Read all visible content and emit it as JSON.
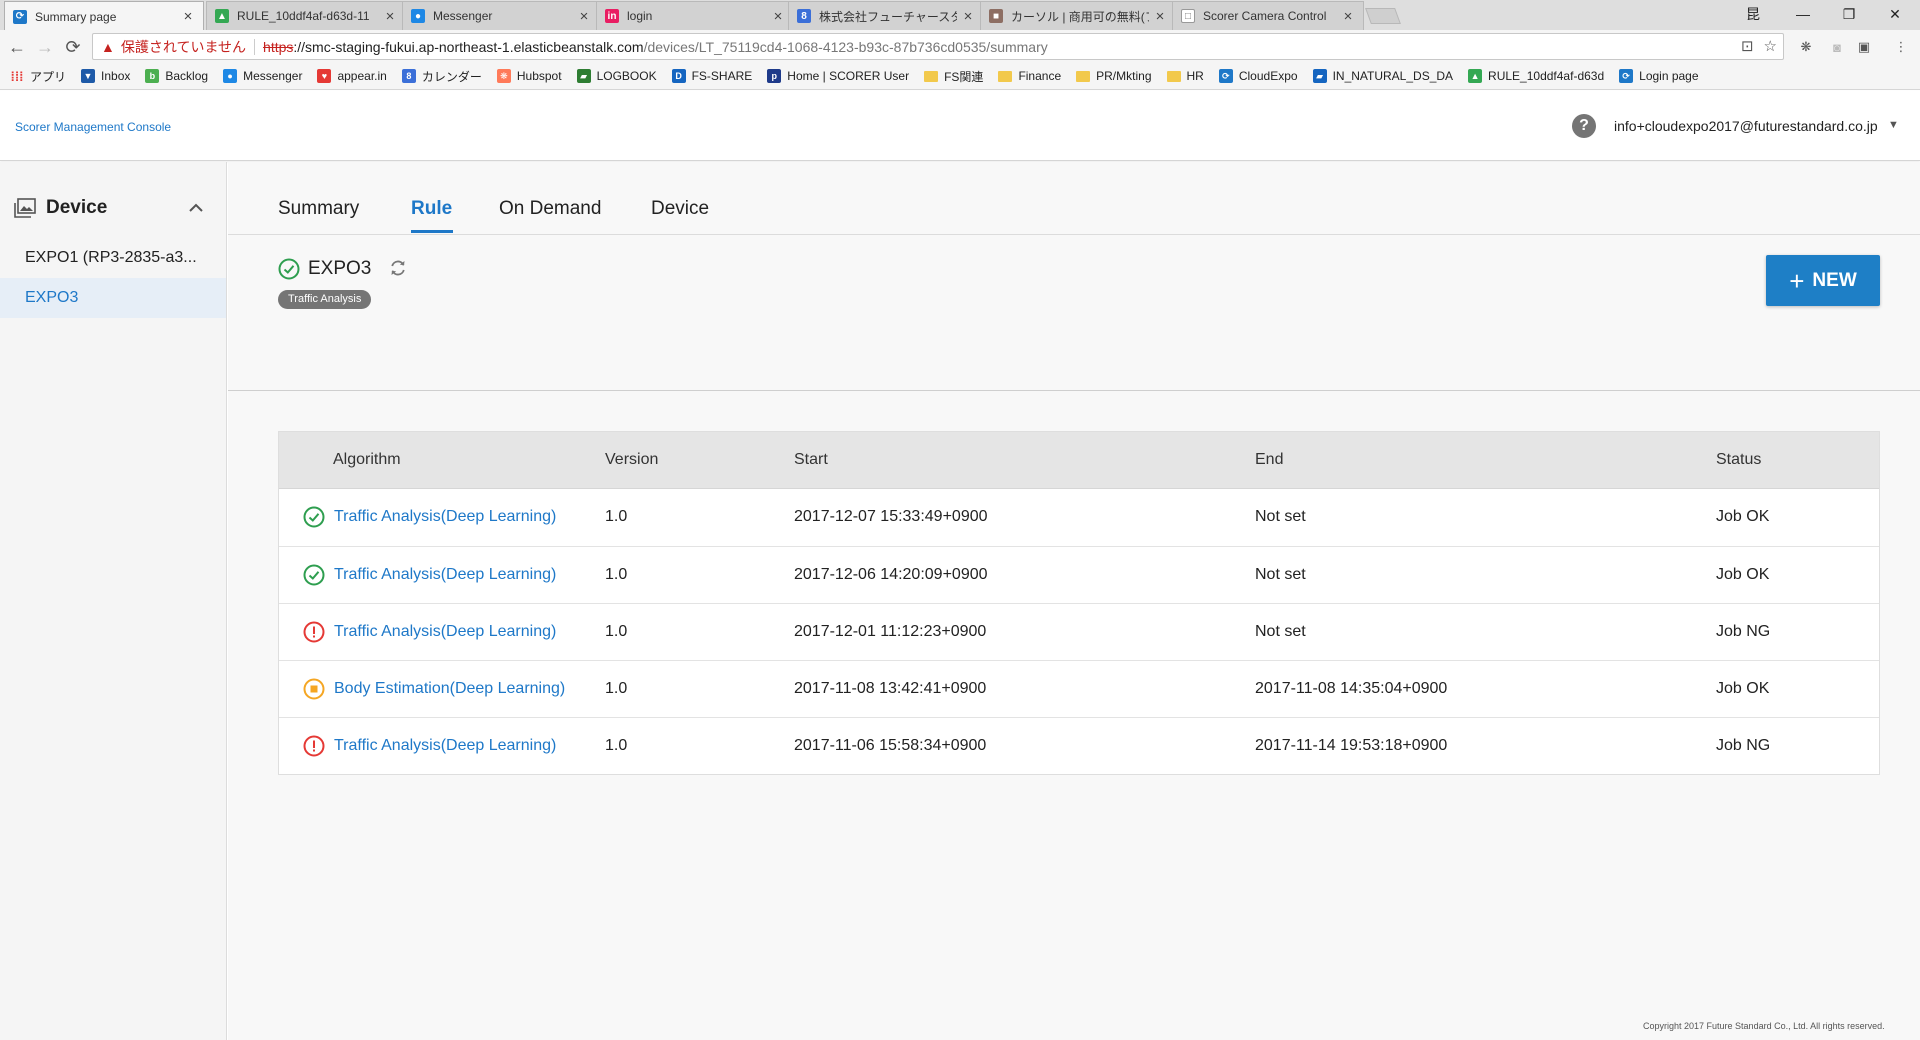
{
  "browser": {
    "tabs": [
      {
        "title": "Summary page",
        "fav_color": "#1e78c8",
        "fav_glyph": "⟳"
      },
      {
        "title": "RULE_10ddf4af-d63d-11",
        "fav_color": "#34a853",
        "fav_glyph": "▲"
      },
      {
        "title": "Messenger",
        "fav_color": "#1e88e5",
        "fav_glyph": "●"
      },
      {
        "title": "login",
        "fav_color": "#e91e63",
        "fav_glyph": "in"
      },
      {
        "title": "株式会社フューチャースタンダ",
        "fav_color": "#3b6fd8",
        "fav_glyph": "8"
      },
      {
        "title": "カーソル | 商用可の無料(フ",
        "fav_color": "#8d6e63",
        "fav_glyph": "■"
      },
      {
        "title": "Scorer Camera Control",
        "fav_color": "#ffffff",
        "fav_glyph": "□"
      }
    ],
    "window_controls": {
      "profile": "昆",
      "minimize": "—",
      "restore": "❐",
      "close": "✕"
    },
    "omnibox": {
      "security_warning": "保護されていません",
      "scheme": "https",
      "host_url": "://smc-staging-fukui.ap-northeast-1.elasticbeanstalk.com",
      "path": "/devices/LT_75119cd4-1068-4123-b93c-87b736cd0535/summary"
    },
    "bookmarks": [
      {
        "label": "アプリ",
        "type": "apps",
        "color": "#e53935"
      },
      {
        "label": "Inbox",
        "type": "icon",
        "color": "#1e5aa8",
        "glyph": "▼"
      },
      {
        "label": "Backlog",
        "type": "icon",
        "color": "#4caf50",
        "glyph": "b"
      },
      {
        "label": "Messenger",
        "type": "icon",
        "color": "#1e88e5",
        "glyph": "●"
      },
      {
        "label": "appear.in",
        "type": "icon",
        "color": "#e53935",
        "glyph": "♥"
      },
      {
        "label": "カレンダー",
        "type": "icon",
        "color": "#3b6fd8",
        "glyph": "8"
      },
      {
        "label": "Hubspot",
        "type": "icon",
        "color": "#ff7a59",
        "glyph": "❋"
      },
      {
        "label": "LOGBOOK",
        "type": "icon",
        "color": "#2e7d32",
        "glyph": "▰"
      },
      {
        "label": "FS-SHARE",
        "type": "icon",
        "color": "#1565c0",
        "glyph": "D"
      },
      {
        "label": "Home | SCORER User",
        "type": "icon",
        "color": "#1e3a8a",
        "glyph": "p"
      },
      {
        "label": "FS関連",
        "type": "folder"
      },
      {
        "label": "Finance",
        "type": "folder"
      },
      {
        "label": "PR/Mkting",
        "type": "folder"
      },
      {
        "label": "HR",
        "type": "folder"
      },
      {
        "label": "CloudExpo",
        "type": "icon",
        "color": "#1e78c8",
        "glyph": "⟳"
      },
      {
        "label": "IN_NATURAL_DS_DA",
        "type": "icon",
        "color": "#1565c0",
        "glyph": "▰"
      },
      {
        "label": "RULE_10ddf4af-d63d",
        "type": "icon",
        "color": "#34a853",
        "glyph": "▲"
      },
      {
        "label": "Login page",
        "type": "icon",
        "color": "#1e78c8",
        "glyph": "⟳"
      }
    ]
  },
  "header": {
    "brand": "Scorer Management Console",
    "user_email": "info+cloudexpo2017@futurestandard.co.jp"
  },
  "sidebar": {
    "title": "Device",
    "items": [
      {
        "label": "EXPO1 (RP3-2835-a3...",
        "selected": false
      },
      {
        "label": "EXPO3",
        "selected": true
      }
    ]
  },
  "tabs": [
    {
      "label": "Summary",
      "active": false
    },
    {
      "label": "Rule",
      "active": true
    },
    {
      "label": "On Demand",
      "active": false
    },
    {
      "label": "Device",
      "active": false
    }
  ],
  "device": {
    "name": "EXPO3",
    "badge": "Traffic Analysis",
    "new_button": "NEW"
  },
  "table": {
    "columns": [
      "Algorithm",
      "Version",
      "Start",
      "End",
      "Status"
    ],
    "rows": [
      {
        "status_icon": "ok",
        "algorithm": "Traffic Analysis(Deep Learning)",
        "version": "1.0",
        "start": "2017-12-07 15:33:49+0900",
        "end": "Not set",
        "status": "Job OK"
      },
      {
        "status_icon": "ok",
        "algorithm": "Traffic Analysis(Deep Learning)",
        "version": "1.0",
        "start": "2017-12-06 14:20:09+0900",
        "end": "Not set",
        "status": "Job OK"
      },
      {
        "status_icon": "error",
        "algorithm": "Traffic Analysis(Deep Learning)",
        "version": "1.0",
        "start": "2017-12-01 11:12:23+0900",
        "end": "Not set",
        "status": "Job NG"
      },
      {
        "status_icon": "stopped",
        "algorithm": "Body Estimation(Deep Learning)",
        "version": "1.0",
        "start": "2017-11-08 13:42:41+0900",
        "end": "2017-11-08 14:35:04+0900",
        "status": "Job OK"
      },
      {
        "status_icon": "error",
        "algorithm": "Traffic Analysis(Deep Learning)",
        "version": "1.0",
        "start": "2017-11-06 15:58:34+0900",
        "end": "2017-11-14 19:53:18+0900",
        "status": "Job NG"
      }
    ]
  },
  "colors": {
    "accent": "#1e78c8",
    "ok": "#2e9e4f",
    "error": "#e53935",
    "stopped": "#f5a623"
  },
  "footer": "Copyright 2017 Future Standard Co., Ltd. All rights reserved."
}
